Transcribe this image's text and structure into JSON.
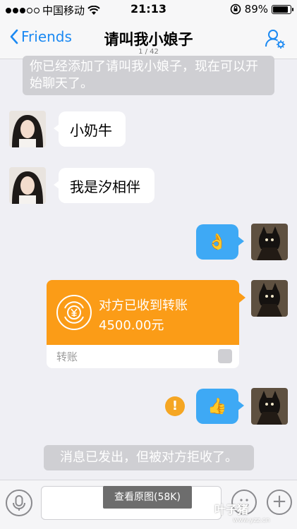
{
  "status": {
    "carrier": "中国移动",
    "time": "21:13",
    "battery": "89%",
    "battery_level": 0.89
  },
  "nav": {
    "back_label": "Friends",
    "title": "请叫我小娘子",
    "pager": "1 / 42"
  },
  "messages": {
    "system_top": "你已经添加了请叫我小娘子，现在可以开始聊天了。",
    "in1": "小奶牛",
    "in2": "我是汐相伴",
    "out_emoji1": "👌",
    "transfer": {
      "line1": "对方已收到转账",
      "line2": "4500.00元",
      "footer": "转账"
    },
    "out_emoji2": "👍",
    "warning_mark": "!",
    "system_bottom": "消息已发出，但被对方拒收了。"
  },
  "input": {
    "view_original": "查看原图(58K)",
    "plus": "+"
  },
  "watermark": {
    "main": "叶子猪",
    "sub": "www.yzz.cn"
  },
  "colors": {
    "accent": "#1b89f2",
    "bubble_out": "#3ea9f5",
    "transfer": "#fb9c17",
    "warning": "#f5a623"
  }
}
